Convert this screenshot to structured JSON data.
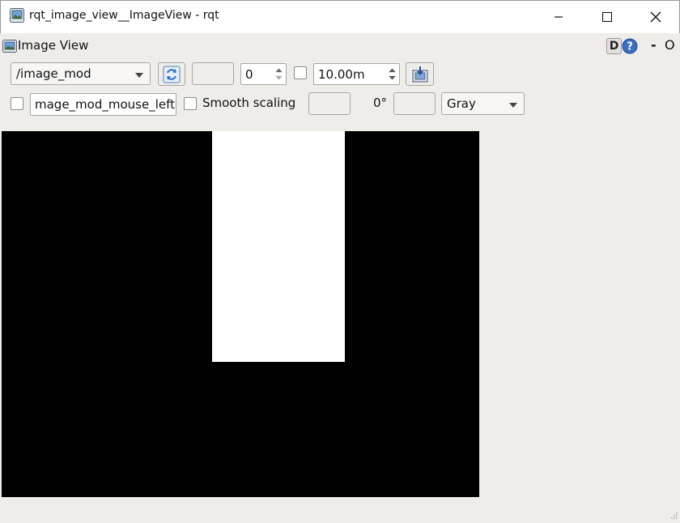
{
  "window": {
    "title": "rqt_image_view__ImageView - rqt",
    "icon": "app-image-icon",
    "controls": [
      "minimize-icon",
      "maximize-icon",
      "close-icon"
    ]
  },
  "plugin": {
    "title": "Image View",
    "dock_label": "D",
    "help_icon": "help-icon",
    "dash_label": "-",
    "o_label": "O"
  },
  "toolbar": {
    "topic": "/image_mod",
    "spin_value": "0",
    "duration": "10.00m",
    "mouse_topic": "mage_mod_mouse_left",
    "smooth_scaling_label": "Smooth scaling",
    "rotation": "0°",
    "color_scheme": "Gray",
    "checkbox_1_checked": false,
    "checkbox_2_checked": false,
    "smooth_scaling_checked": false
  },
  "image": {
    "background_color": "#000000",
    "block_color": "#ffffff"
  }
}
